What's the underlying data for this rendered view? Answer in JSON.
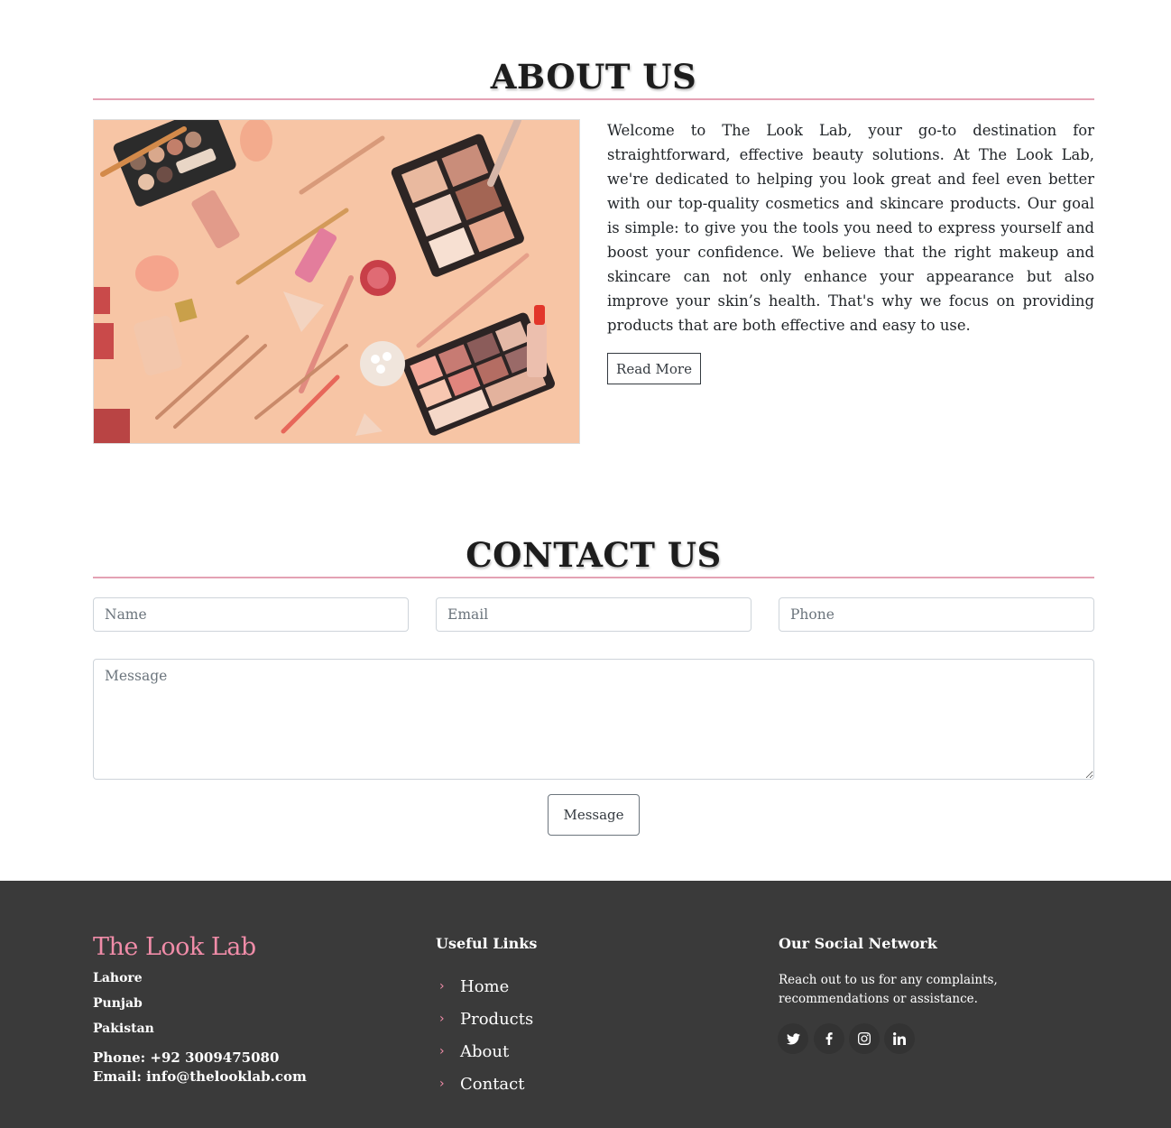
{
  "about": {
    "title": "ABOUT US",
    "body": "Welcome to The Look Lab, your go-to destination for straightforward, effective beauty solutions. At The Look Lab, we're dedicated to helping you look great and feel even better with our top-quality cosmetics and skincare products. Our goal is simple: to give you the tools you need to express yourself and boost your confidence. We believe that the right makeup and skincare can not only enhance your appearance but also improve your skin’s health. That's why we focus on providing products that are both effective and easy to use.",
    "button": "Read More"
  },
  "contact": {
    "title": "CONTACT US",
    "name_placeholder": "Name",
    "email_placeholder": "Email",
    "phone_placeholder": "Phone",
    "message_placeholder": "Message",
    "button": "Message"
  },
  "footer": {
    "brand": "The Look Lab",
    "address": [
      "Lahore",
      "Punjab",
      "Pakistan"
    ],
    "phone": "Phone: +92 3009475080",
    "email": "Email: info@thelooklab.com",
    "links_heading": "Useful Links",
    "links": [
      "Home",
      "Products",
      "About",
      "Contact"
    ],
    "social_heading": "Our Social Network",
    "social_text": "Reach out to us for any complaints, recommendations or assistance.",
    "social_icons": [
      "twitter-icon",
      "facebook-icon",
      "instagram-icon",
      "linkedin-icon"
    ]
  },
  "colors": {
    "accent": "#f08ca8",
    "divider": "#e4a2b4",
    "footer_bg": "#3a3a3a",
    "image_bg": "#f7c9a9"
  }
}
